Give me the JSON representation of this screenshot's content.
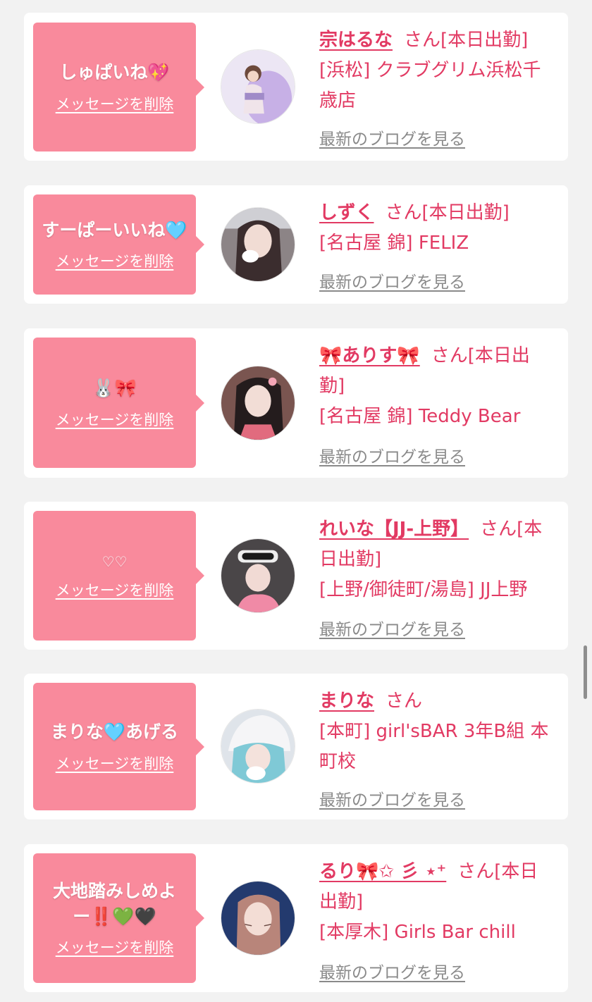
{
  "list": [
    {
      "message": "しゅぱいね💖",
      "delete_label": "メッセージを削除",
      "name": "宗はるな",
      "suffix": "さん[本日出勤]",
      "area": "[浜松] クラブグリム浜松千歳店",
      "blog_label": "最新のブログを見る",
      "avatar_bg": "#d9c9ec"
    },
    {
      "message": "すーぱーいいね🩵",
      "delete_label": "メッセージを削除",
      "name": "しずく",
      "suffix": "さん[本日出勤]",
      "area": "[名古屋 錦] FELIZ",
      "blog_label": "最新のブログを見る",
      "avatar_bg": "#7a7476"
    },
    {
      "message": "🐰🎀",
      "delete_label": "メッセージを削除",
      "name": "🎀ありす🎀",
      "suffix": "さん[本日出勤]",
      "area": "[名古屋 錦] Teddy Bear",
      "blog_label": "最新のブログを見る",
      "avatar_bg": "#6a4a4a"
    },
    {
      "message": "♡♡",
      "delete_label": "メッセージを削除",
      "name": "れいな【JJ-上野】",
      "suffix": "さん[本日出勤]",
      "area": "[上野/御徒町/湯島] JJ上野",
      "blog_label": "最新のブログを見る",
      "avatar_bg": "#3d3a3c"
    },
    {
      "message": "まりな🩵あげる",
      "delete_label": "メッセージを削除",
      "name": "まりな",
      "suffix": "さん",
      "area": "[本町] girl'sBAR 3年B組 本町校",
      "blog_label": "最新のブログを見る",
      "avatar_bg": "#cfd6df"
    },
    {
      "message": "大地踏みしめよー‼️💚🖤",
      "delete_label": "メッセージを削除",
      "name": "るり🎀✩ 彡 ⋆⁺",
      "suffix": "さん[本日出勤]",
      "area": "[本厚木] Girls Bar chill",
      "blog_label": "最新のブログを見る",
      "avatar_bg": "#233a6e"
    }
  ]
}
